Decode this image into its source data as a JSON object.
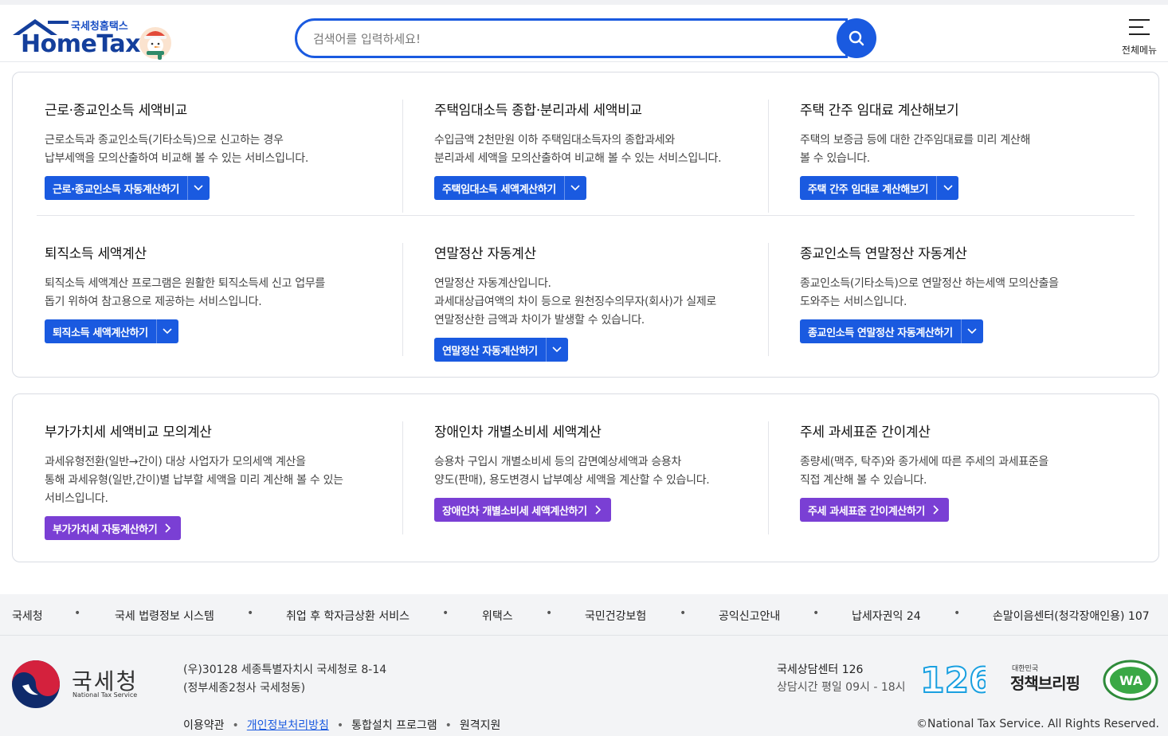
{
  "header": {
    "brand_kr": "국세청홈택스",
    "brand_en": "HomeTax",
    "search_placeholder": "검색어를 입력하세요!",
    "menu_label": "전체메뉴"
  },
  "panel1": {
    "items": [
      {
        "title": "근로·종교인소득 세액비교",
        "desc": "근로소득과 종교인소득(기타소득)으로 신고하는 경우\n납부세액을 모의산출하여 비교해 볼 수 있는 서비스입니다.",
        "button": "근로·종교인소득 자동계산하기"
      },
      {
        "title": "주택임대소득 종합·분리과세 세액비교",
        "desc": "수입금액 2천만원 이하 주택임대소득자의 종합과세와\n분리과세 세액을 모의산출하여 비교해 볼 수 있는 서비스입니다.",
        "button": "주택임대소득 세액계산하기"
      },
      {
        "title": "주택 간주 임대료 계산해보기",
        "desc": "주택의 보증금 등에 대한 간주임대료를 미리 계산해\n볼 수 있습니다.",
        "button": "주택 간주 임대료 계산해보기"
      },
      {
        "title": "퇴직소득 세액계산",
        "desc": "퇴직소득 세액계산 프로그램은 원활한 퇴직소득세 신고 업무를\n돕기 위하여 참고용으로 제공하는 서비스입니다.",
        "button": "퇴직소득 세액계산하기"
      },
      {
        "title": "연말정산 자동계산",
        "desc": "연말정산 자동계산입니다.\n과세대상급여액의 차이 등으로 원천징수의무자(회사)가 실제로\n연말정산한 금액과 차이가 발생할 수 있습니다.",
        "button": "연말정산 자동계산하기"
      },
      {
        "title": "종교인소득 연말정산 자동계산",
        "desc": "종교인소득(기타소득)으로 연말정산 하는세액 모의산출을\n도와주는 서비스입니다.",
        "button": "종교인소득 연말정산 자동계산하기"
      }
    ]
  },
  "panel2": {
    "items": [
      {
        "title": "부가가치세 세액비교 모의계산",
        "desc": "과세유형전환(일반→간이) 대상 사업자가 모의세액 계산을\n통해 과세유형(일반,간이)별 납부할 세액을 미리 계산해 볼 수 있는\n서비스입니다.",
        "button": "부가가치세 자동계산하기"
      },
      {
        "title": "장애인차 개별소비세 세액계산",
        "desc": "승용차 구입시 개별소비세 등의 감면예상세액과 승용차\n양도(판매), 용도변경시 납부예상 세액을 계산할 수 있습니다.",
        "button": "장애인차 개별소비세 세액계산하기"
      },
      {
        "title": "주세 과세표준 간이계산",
        "desc": "종량세(맥주, 탁주)와 종가세에 따른 주세의 과세표준을\n직접 계산해 볼 수 있습니다.",
        "button": "주세 과세표준 간이계산하기"
      }
    ]
  },
  "footer": {
    "links": [
      "국세청",
      "국세 법령정보 시스템",
      "취업 후 학자금상환 서비스",
      "위택스",
      "국민건강보험",
      "공익신고안내",
      "납세자권익 24",
      "손말이음센터(청각장애인용) 107"
    ],
    "nts_name": "국세청",
    "nts_sub": "National Tax Service",
    "address_1": "(우)30128 세종특별자치시 국세청로 8-14",
    "address_2": "(정부세종2청사 국세청동)",
    "bottom_links": [
      "이용약관",
      "개인정보처리방침",
      "통합설치 프로그램",
      "원격지원"
    ],
    "call_title": "국세상담센터 126",
    "call_hours": "상담시간 평일 09시 - 18시",
    "badge_126": "126",
    "policy_small": "대한민국",
    "policy_big": "정책브리핑",
    "wa_label": "WA",
    "copyright": "©National Tax Service. All Rights Reserved."
  },
  "colors": {
    "primary_blue": "#1a5ae0",
    "purple": "#7a3fd4",
    "navy": "#143f9c"
  }
}
